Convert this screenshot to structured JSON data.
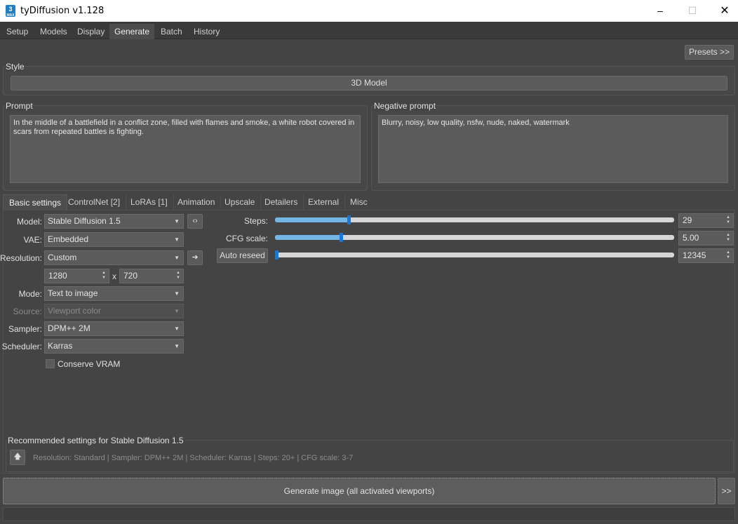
{
  "window": {
    "title": "tyDiffusion v1.128",
    "icon_text": "3",
    "icon_sub": "MAX"
  },
  "main_tabs": [
    "Setup",
    "Models",
    "Display",
    "Generate",
    "Batch",
    "History"
  ],
  "presets_label": "Presets >>",
  "style": {
    "label": "Style",
    "value": "3D Model"
  },
  "prompt": {
    "label": "Prompt",
    "text": "In the middle of a battlefield in a conflict zone, filled with flames and smoke, a white robot covered in scars from repeated battles is fighting."
  },
  "negative_prompt": {
    "label": "Negative prompt",
    "text": "Blurry, noisy, low quality, nsfw, nude, naked, watermark"
  },
  "sub_tabs": [
    "Basic settings",
    "ControlNet [2]",
    "LoRAs [1]",
    "Animation",
    "Upscale",
    "Detailers",
    "External",
    "Misc"
  ],
  "basic": {
    "model_label": "Model:",
    "model_value": "Stable Diffusion 1.5",
    "vae_label": "VAE:",
    "vae_value": "Embedded",
    "resolution_label": "Resolution:",
    "resolution_value": "Custom",
    "width": "1280",
    "x_sep": "x",
    "height": "720",
    "mode_label": "Mode:",
    "mode_value": "Text to image",
    "source_label": "Source:",
    "source_value": "Viewport color",
    "sampler_label": "Sampler:",
    "sampler_value": "DPM++ 2M",
    "scheduler_label": "Scheduler:",
    "scheduler_value": "Karras",
    "conserve_vram_label": "Conserve VRAM",
    "conserve_vram_checked": false
  },
  "sliders": {
    "steps_label": "Steps:",
    "steps_value": "29",
    "steps_fraction": 0.185,
    "cfg_label": "CFG scale:",
    "cfg_value": "5.00",
    "cfg_fraction": 0.166,
    "auto_reseed_label": "Auto reseed",
    "seed_value": "12345",
    "seed_fraction": 0.0
  },
  "recommended": {
    "label": "Recommended settings for Stable Diffusion 1.5",
    "text": "Resolution: Standard | Sampler: DPM++ 2M | Scheduler: Karras | Steps: 20+ | CFG scale: 3-7"
  },
  "generate_label": "Generate image (all activated viewports)",
  "more_label": ">>",
  "colors": {
    "accent": "#1b78d0",
    "slider_fill": "#73b6e6",
    "background": "#444444"
  }
}
